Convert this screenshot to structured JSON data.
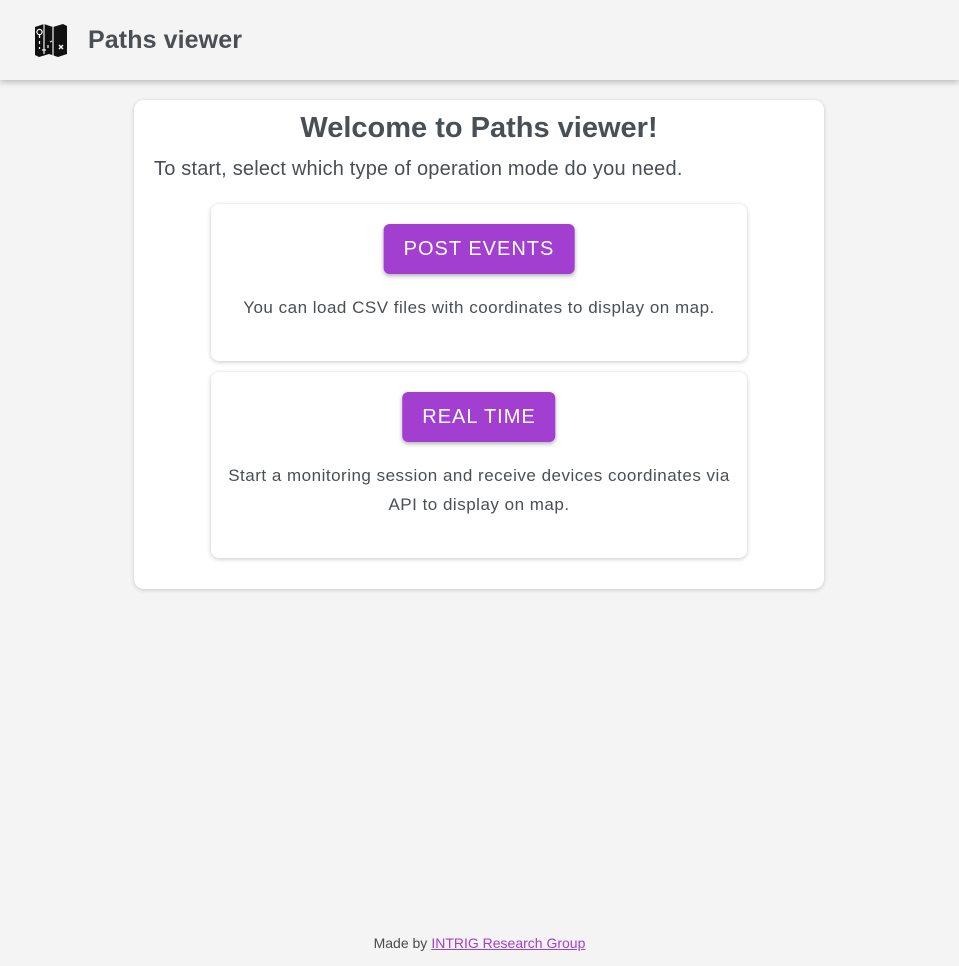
{
  "header": {
    "logo_icon": "map-icon",
    "title": "Paths viewer"
  },
  "main": {
    "heading": "Welcome to Paths viewer!",
    "intro": "To start, select which type of operation mode do you need.",
    "modes": [
      {
        "button_label": "POST EVENTS",
        "description": "You can load CSV files with coordinates to display on map."
      },
      {
        "button_label": "REAL TIME",
        "description": "Start a monitoring session and receive devices coordinates via API to display on map."
      }
    ]
  },
  "footer": {
    "made_by": "Made by",
    "link_text": "INTRIG Research Group"
  },
  "colors": {
    "accent": "#a23fd0",
    "background": "#f4f4f4",
    "card": "#ffffff",
    "text": "#4a4f55"
  }
}
